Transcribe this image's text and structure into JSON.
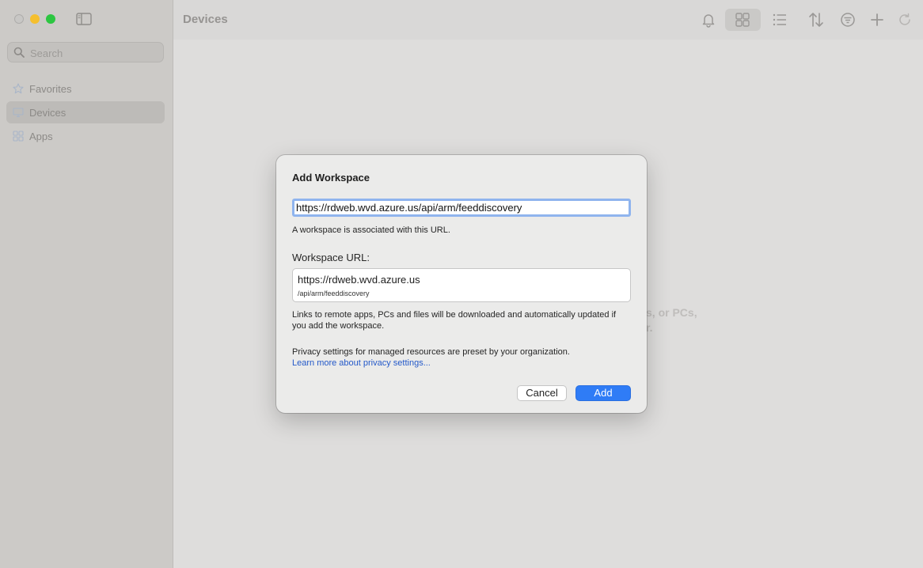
{
  "window": {
    "title": "Devices"
  },
  "search": {
    "placeholder": "Search"
  },
  "sidebar": {
    "items": [
      {
        "label": "Favorites",
        "active": false
      },
      {
        "label": "Devices",
        "active": true
      },
      {
        "label": "Apps",
        "active": false
      }
    ]
  },
  "toolbar": {
    "icons": [
      "bell-icon",
      "grid-view-icon",
      "list-view-icon",
      "sort-icon",
      "filter-icon",
      "plus-icon",
      "refresh-icon"
    ]
  },
  "background": {
    "line1": "s, or PCs,",
    "line2": "r."
  },
  "dialog": {
    "title": "Add Workspace",
    "url_value": "https://rdweb.wvd.azure.us/api/arm/feeddiscovery",
    "hint": "A workspace is associated with this URL.",
    "workspace_label": "Workspace URL:",
    "workspace_url_main": "https://rdweb.wvd.azure.us",
    "workspace_url_path": "/api/arm/feeddiscovery",
    "info_download": "Links to remote apps, PCs and files will be downloaded and automatically updated if you add the workspace.",
    "info_privacy": "Privacy settings for managed resources are preset by your organization.",
    "learn_more": "Learn more about privacy settings...",
    "cancel_label": "Cancel",
    "add_label": "Add"
  },
  "colors": {
    "accent": "#2f7cf6",
    "link": "#2459c9",
    "focus_ring": "#8fb4ee"
  }
}
